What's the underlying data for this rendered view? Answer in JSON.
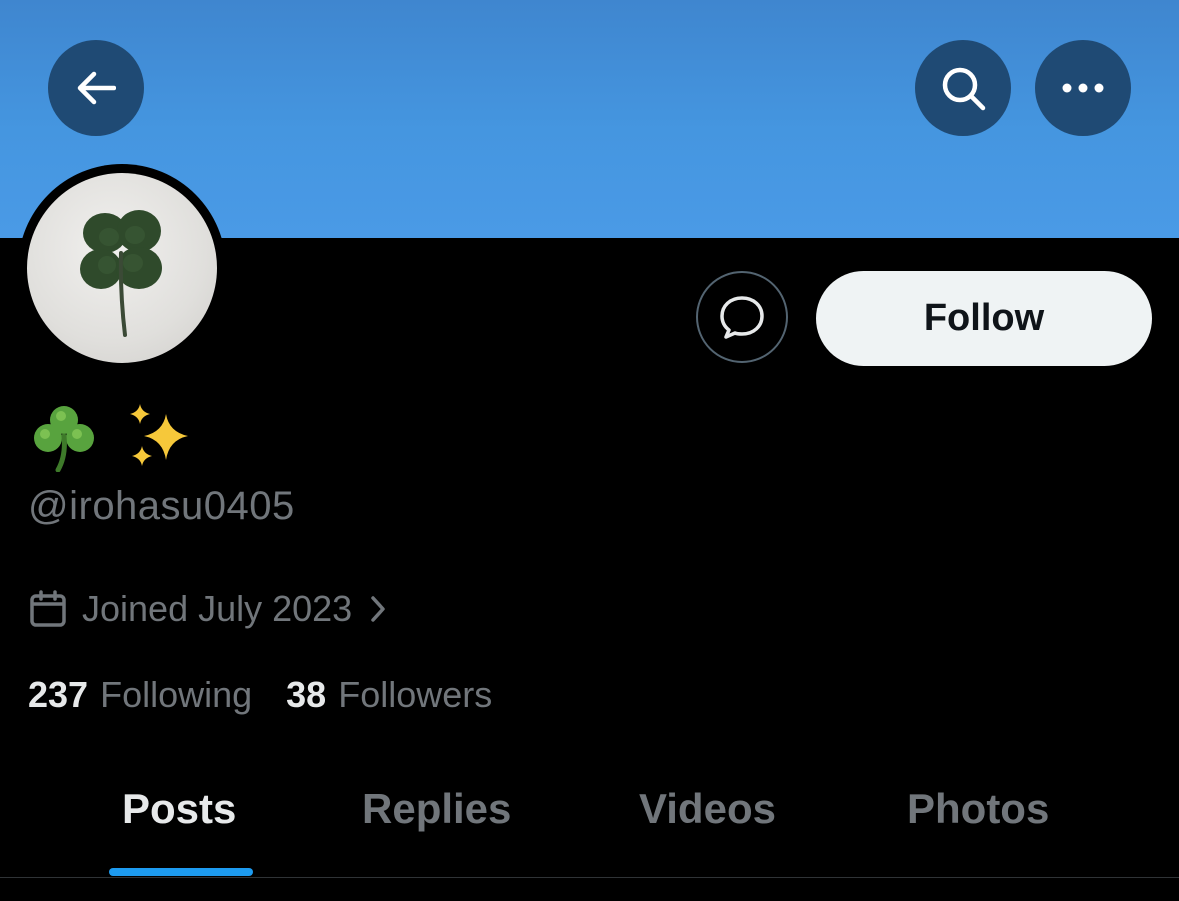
{
  "profile": {
    "display_name_emoji_1": "☘️",
    "display_name_emoji_2": "✨",
    "handle": "@irohasu0405",
    "joined": "Joined July 2023",
    "following_count": "237",
    "following_label": "Following",
    "followers_count": "38",
    "followers_label": "Followers"
  },
  "actions": {
    "follow_label": "Follow"
  },
  "tabs": [
    {
      "label": "Posts",
      "active": true
    },
    {
      "label": "Replies",
      "active": false
    },
    {
      "label": "Videos",
      "active": false
    },
    {
      "label": "Photos",
      "active": false
    }
  ],
  "icons": {
    "back": "arrow-left-icon",
    "search": "search-icon",
    "more": "more-horizontal-icon",
    "message": "message-bubble-icon",
    "calendar": "calendar-icon",
    "chevron": "chevron-right-icon"
  },
  "colors": {
    "banner": "#4596e0",
    "overlay_button": "#1f4a74",
    "accent": "#1d9bf0",
    "muted_text": "#71767b",
    "follow_button_bg": "#eff3f4"
  }
}
